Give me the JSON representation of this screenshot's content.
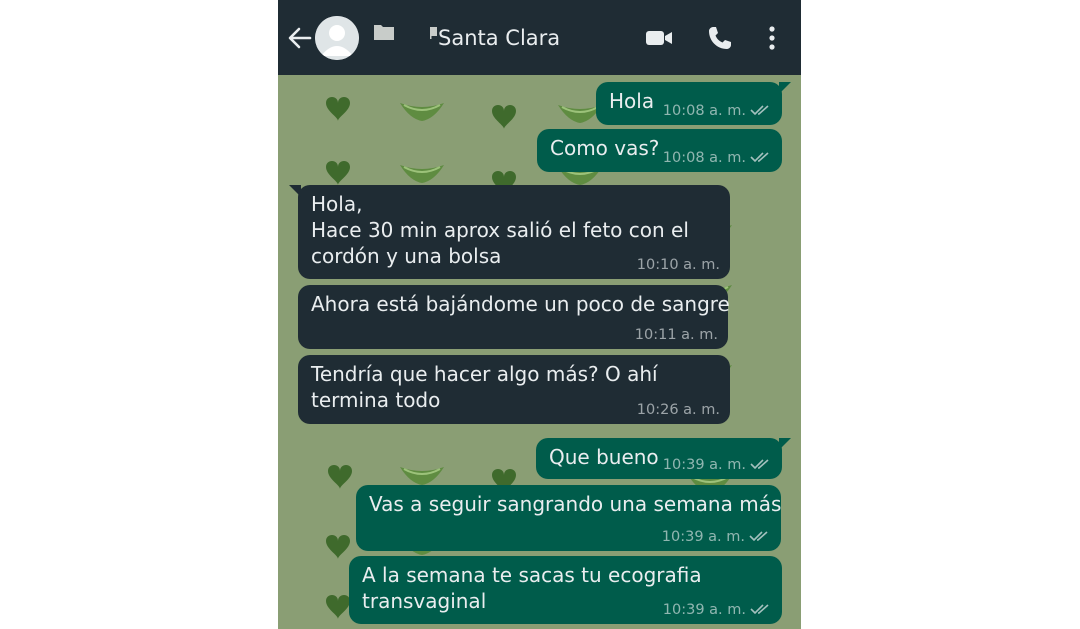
{
  "header": {
    "contact_name": "Santa Clara",
    "icons": [
      "back-arrow-icon",
      "avatar-icon",
      "folder-icon",
      "video-call-icon",
      "phone-icon",
      "more-vert-icon"
    ]
  },
  "colors": {
    "header_bg": "#1f2c34",
    "outgoing_bubble": "#005c4b",
    "incoming_bubble": "#1f2c34",
    "wallpaper": "#8a9e74",
    "text": "#e9edef"
  },
  "messages": [
    {
      "direction": "out",
      "text": "Hola",
      "time": "10:08 a. m."
    },
    {
      "direction": "out",
      "text": "Como vas?",
      "time": "10:08 a. m."
    },
    {
      "direction": "in",
      "text": "Hola,\nHace 30 min aprox salió el feto con el\ncordón y una bolsa",
      "time": "10:10 a. m."
    },
    {
      "direction": "in",
      "text": "Ahora está bajándome un poco de sangre",
      "time": "10:11 a. m."
    },
    {
      "direction": "in",
      "text": "Tendría que hacer algo más? O ahí\ntermina todo",
      "time": "10:26 a. m."
    },
    {
      "direction": "out",
      "text": "Que bueno",
      "time": "10:39 a. m."
    },
    {
      "direction": "out",
      "text": "Vas a seguir sangrando una semana más",
      "time": "10:39 a. m."
    },
    {
      "direction": "out",
      "text": "A la semana te sacas tu ecografia\ntransvaginal",
      "time": "10:39 a. m."
    }
  ]
}
